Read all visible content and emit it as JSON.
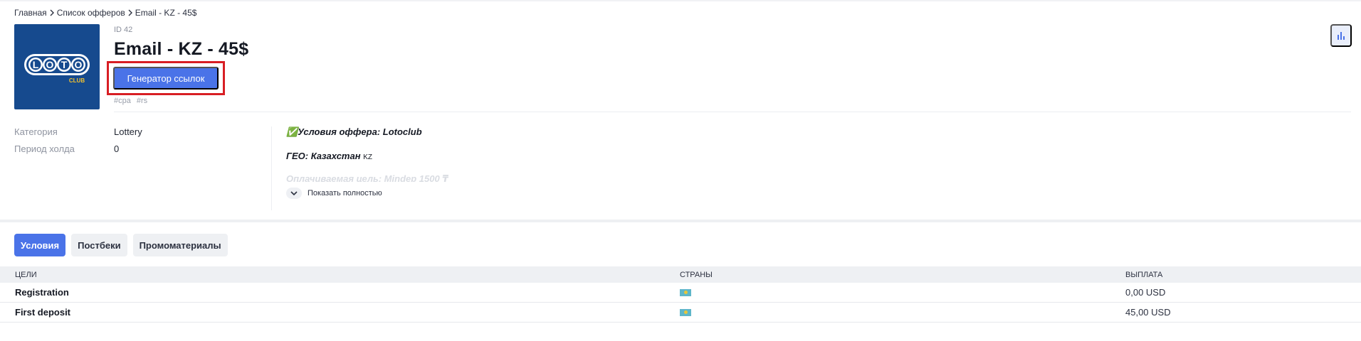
{
  "breadcrumb": {
    "items": [
      "Главная",
      "Список офферов",
      "Email - KZ - 45$"
    ]
  },
  "offer": {
    "logo_text_main": "LOTO",
    "logo_text_sub": "CLUB",
    "id_label": "ID 42",
    "title": "Email - KZ - 45$",
    "link_generator_label": "Генератор ссылок",
    "tags": [
      "#cpa",
      "#rs"
    ]
  },
  "info": {
    "category_label": "Категория",
    "category_value": "Lottery",
    "hold_label": "Период холда",
    "hold_value": "0"
  },
  "description": {
    "line1": "✅Условия оффера: Lotoclub",
    "line2": "ГЕО: Казахстан",
    "line2_small": "KZ",
    "line3_faded": "Оплачиваемая цель: Mindep 1500 ₸",
    "show_more": "Показать полностью"
  },
  "tabs": [
    {
      "label": "Условия",
      "active": true
    },
    {
      "label": "Постбеки",
      "active": false
    },
    {
      "label": "Промоматериалы",
      "active": false
    }
  ],
  "table": {
    "headers": [
      "ЦЕЛИ",
      "СТРАНЫ",
      "ВЫПЛАТА"
    ],
    "rows": [
      {
        "goal": "Registration",
        "country_flag": "kz-flag-icon",
        "payout": "0,00 USD"
      },
      {
        "goal": "First deposit",
        "country_flag": "kz-flag-icon",
        "payout": "45,00 USD"
      }
    ]
  },
  "colors": {
    "accent": "#4a73e8",
    "highlight": "#d81e24",
    "logo_bg": "#164a8e"
  },
  "icons": {
    "chart_button": "bar-chart-icon",
    "breadcrumb_sep": "chevron-right-icon",
    "show_more": "chevron-down-icon"
  }
}
